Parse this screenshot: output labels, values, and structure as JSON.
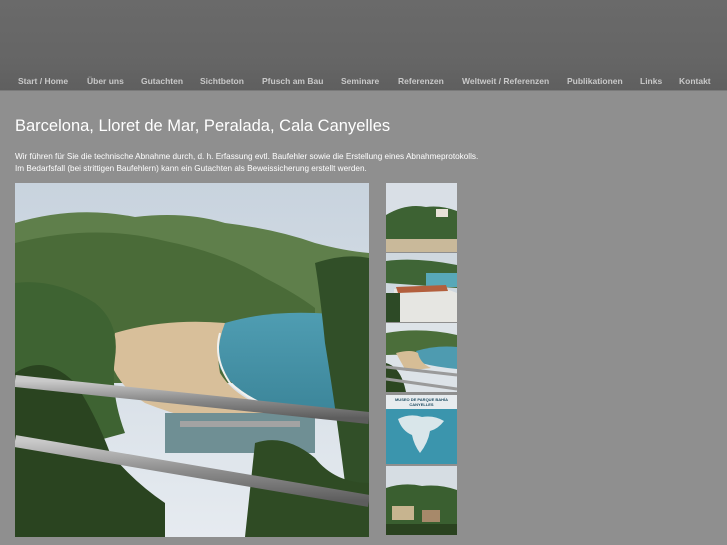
{
  "nav": {
    "items": [
      {
        "label": "Start / Home"
      },
      {
        "label": "Über uns"
      },
      {
        "label": "Gutachten"
      },
      {
        "label": "Sichtbeton"
      },
      {
        "label": "Pfusch am Bau"
      },
      {
        "label": "Seminare"
      },
      {
        "label": "Referenzen"
      },
      {
        "label": "Weltweit / Referenzen"
      },
      {
        "label": "Publikationen"
      },
      {
        "label": "Links"
      },
      {
        "label": "Kontakt"
      }
    ]
  },
  "page": {
    "title": "Barcelona, Lloret de Mar, Peralada, Cala Canyelles",
    "intro_line1": "Wir führen für Sie die technische Abnahme durch, d. h. Erfassung evtl. Baufehler sowie die Erstellung eines Abnahmeprotokolls.",
    "intro_line2": "Im Bedarfsfall (bei strittigen Baufehlern) kann ein Gutachten als Beweissicherung erstellt werden."
  },
  "gallery": {
    "thumb_map_sign_text": "MUSEO DE PARQUE BAHÍA CANYELLES"
  }
}
